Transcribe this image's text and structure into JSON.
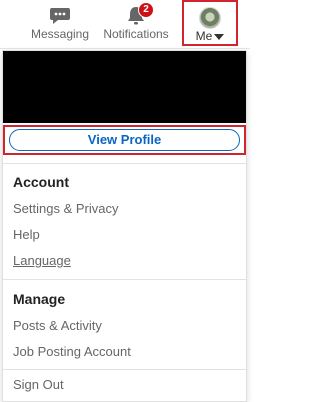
{
  "nav": {
    "messaging_label": "Messaging",
    "notifications_label": "Notifications",
    "notifications_count": "2",
    "me_label": "Me"
  },
  "dropdown": {
    "view_profile_label": "View Profile",
    "account_heading": "Account",
    "account_items": [
      "Settings & Privacy",
      "Help",
      "Language"
    ],
    "manage_heading": "Manage",
    "manage_items": [
      "Posts & Activity",
      "Job Posting Account"
    ],
    "sign_out_label": "Sign Out"
  },
  "colors": {
    "accent": "#0a66c2",
    "highlight": "#d0252e",
    "badge": "#cc1016"
  }
}
